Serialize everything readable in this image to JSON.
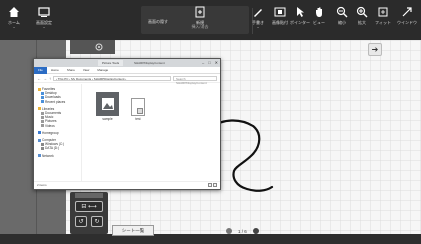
{
  "toolbar": {
    "home_label": "ホーム",
    "layout_label": "画面設定",
    "hide_label": "画面の隠す",
    "new_sheet_label1": "新規",
    "new_sheet_label2": "挿入/消去",
    "pen_label": "手書き",
    "capture_label1": "画像貼付",
    "capture_label2": "",
    "pointer_label": "ポインター",
    "view_label": "ビュー",
    "zoom_out_label": "縮小",
    "zoom_in_label": "拡大",
    "fit_label": "フィット",
    "window_label": "ウインドウ"
  },
  "explorer": {
    "tab_label": "Picture Tools",
    "window_title": "SHARPDisplayContent",
    "ribbon": [
      "File",
      "Home",
      "Share",
      "View",
      "Manage"
    ],
    "address": "› This PC › My Documents › SHARPDisplayContent ›",
    "search_placeholder": "Search SHARPDisplayContent",
    "nav_items": [
      {
        "label": "Favorites",
        "color": "#e8b33c",
        "sub": false
      },
      {
        "label": "Desktop",
        "color": "#4a90d9",
        "sub": true
      },
      {
        "label": "Downloads",
        "color": "#4a90d9",
        "sub": true
      },
      {
        "label": "Recent places",
        "color": "#4a90d9",
        "sub": true
      },
      {
        "label": "",
        "color": "",
        "sub": false
      },
      {
        "label": "Libraries",
        "color": "#e8b33c",
        "sub": false
      },
      {
        "label": "Documents",
        "color": "#999",
        "sub": true
      },
      {
        "label": "Music",
        "color": "#999",
        "sub": true
      },
      {
        "label": "Pictures",
        "color": "#999",
        "sub": true
      },
      {
        "label": "Videos",
        "color": "#999",
        "sub": true
      },
      {
        "label": "",
        "color": "",
        "sub": false
      },
      {
        "label": "Homegroup",
        "color": "#3b7bd2",
        "sub": false
      },
      {
        "label": "",
        "color": "",
        "sub": false
      },
      {
        "label": "Computer",
        "color": "#5a8fd0",
        "sub": false
      },
      {
        "label": "Windows (C:)",
        "color": "#888",
        "sub": true
      },
      {
        "label": "DATA (D:)",
        "color": "#888",
        "sub": true
      },
      {
        "label": "",
        "color": "",
        "sub": false
      },
      {
        "label": "Network",
        "color": "#5a8fd0",
        "sub": false
      }
    ],
    "files": [
      {
        "name": "sample",
        "type": "image"
      },
      {
        "name": "test",
        "type": "document"
      }
    ],
    "status": "2 items"
  },
  "bottom": {
    "sheet_tab": "シート一覧",
    "page_indicator": "1 / 6"
  },
  "colors": {
    "toolbar_bg": "#2b2b2b",
    "canvas_bg": "#f6f6f6",
    "ink": "#111111"
  }
}
